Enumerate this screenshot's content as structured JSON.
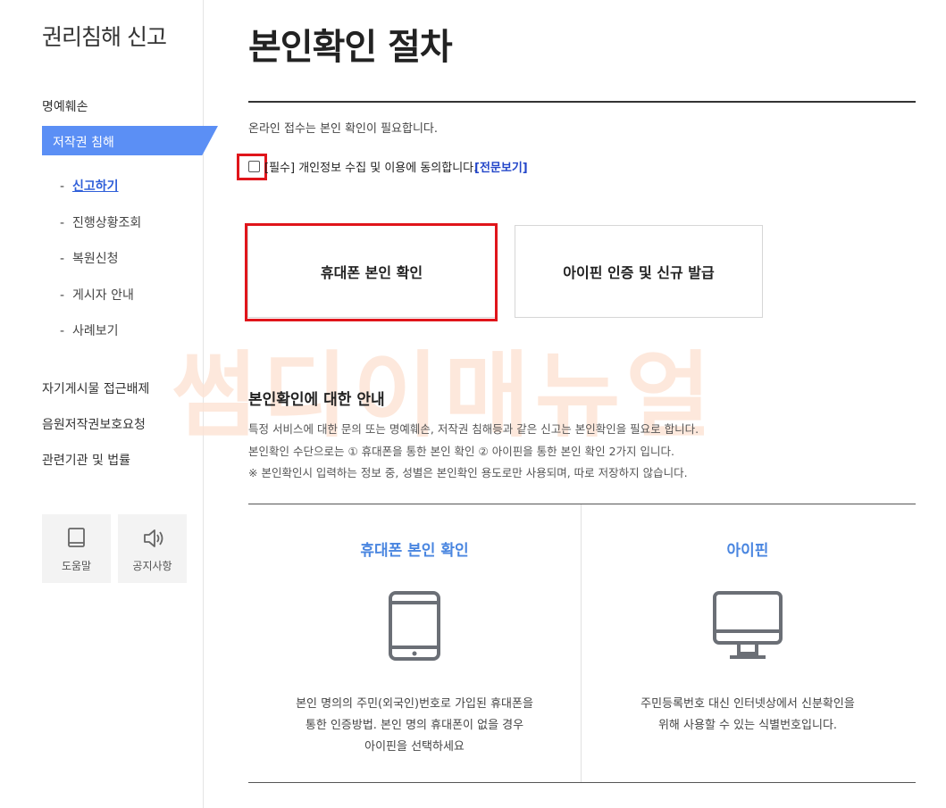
{
  "sidebar": {
    "title": "권리침해 신고",
    "menu": {
      "defamation": "명예훼손",
      "copyright": "저작권 침해",
      "self_post_block": "자기게시물 접근배제",
      "music_copyright": "음원저작권보호요청",
      "related_laws": "관련기관 및 법률"
    },
    "sub_items": [
      {
        "label": "신고하기",
        "current": true
      },
      {
        "label": "진행상황조회",
        "current": false
      },
      {
        "label": "복원신청",
        "current": false
      },
      {
        "label": "게시자 안내",
        "current": false
      },
      {
        "label": "사례보기",
        "current": false
      }
    ],
    "sub_dash": "-",
    "quick_buttons": {
      "help": {
        "label": "도움말",
        "icon": "book-icon"
      },
      "notice": {
        "label": "공지사항",
        "icon": "speaker-icon"
      }
    }
  },
  "main": {
    "title": "본인확인 절차",
    "intro": "온라인 접수는 본인 확인이 필요합니다.",
    "consent": {
      "checked": false,
      "text": "[필수] 개인정보 수집 및 이용에 동의합니다.",
      "link": "[전문보기]"
    },
    "buttons": {
      "phone": "휴대폰 본인 확인",
      "ipin": "아이핀 인증 및 신규 발급"
    },
    "watermark": "썸디이매뉴얼",
    "guide": {
      "title": "본인확인에 대한 안내",
      "lines": [
        "특정 서비스에 대한 문의 또는 명예훼손, 저작권 침해등과 같은 신고는 본인확인을 필요로 합니다.",
        "본인확인 수단으로는 ① 휴대폰을 통한 본인 확인 ② 아이핀을 통한 본인 확인 2가지 입니다.",
        "※ 본인확인시 입력하는 정보 중, 성별은 본인확인 용도로만 사용되며, 따로 저장하지 않습니다."
      ]
    },
    "methods": {
      "phone": {
        "title": "휴대폰 본인 확인",
        "icon": "tablet-icon",
        "desc": [
          "본인 명의의 주민(외국인)번호로 가입된 휴대폰을",
          "통한 인증방법. 본인 명의 휴대폰이 없을 경우",
          "아이핀을 선택하세요"
        ]
      },
      "ipin": {
        "title": "아이핀",
        "icon": "monitor-icon",
        "desc": [
          "주민등록번호 대신 인터넷상에서 신분확인을",
          "위해 사용할 수 있는 식별번호입니다."
        ]
      }
    }
  },
  "colors": {
    "accent": "#5b8ff5",
    "link": "#2346c9",
    "highlight": "#e0151b",
    "method_title": "#4a86e0"
  }
}
